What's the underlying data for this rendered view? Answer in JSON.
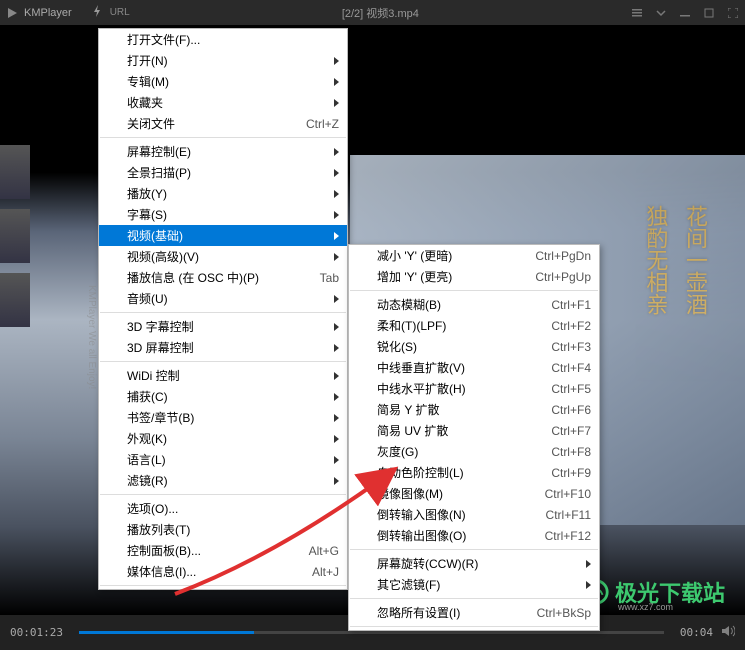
{
  "titlebar": {
    "app_name": "KMPlayer",
    "url_label": "URL",
    "file_info": "[2/2] 视频3.mp4"
  },
  "playbar": {
    "current_time": "00:01:23",
    "total_time": "00:04"
  },
  "sidebar_text": "KMPlayer We all Enjoy!",
  "watermark": {
    "site": "极光下载站",
    "domain": "www.xz7.com"
  },
  "menu1": {
    "open_file": "打开文件(F)...",
    "open": "打开(N)",
    "album": "专辑(M)",
    "favorites": "收藏夹",
    "close_file": "关闭文件",
    "close_file_shortcut": "Ctrl+Z",
    "screen_control": "屏幕控制(E)",
    "panorama": "全景扫描(P)",
    "play": "播放(Y)",
    "subtitles": "字幕(S)",
    "video_basic": "视频(基础)",
    "video_advanced": "视频(高级)(V)",
    "play_info": "播放信息 (在 OSC 中)(P)",
    "play_info_shortcut": "Tab",
    "audio": "音频(U)",
    "subtitle_3d": "3D 字幕控制",
    "screen_3d": "3D 屏幕控制",
    "widi": "WiDi 控制",
    "capture": "捕获(C)",
    "bookmark": "书签/章节(B)",
    "appearance": "外观(K)",
    "language": "语言(L)",
    "filter": "滤镜(R)",
    "options": "选项(O)...",
    "playlist": "播放列表(T)",
    "control_panel": "控制面板(B)...",
    "control_panel_shortcut": "Alt+G",
    "media_info": "媒体信息(I)...",
    "media_info_shortcut": "Alt+J"
  },
  "menu2": {
    "dec_y": "减小 'Y' (更暗)",
    "dec_y_shortcut": "Ctrl+PgDn",
    "inc_y": "增加 'Y' (更亮)",
    "inc_y_shortcut": "Ctrl+PgUp",
    "motion_blur": "动态模糊(B)",
    "motion_blur_shortcut": "Ctrl+F1",
    "soft_lpf": "柔和(T)(LPF)",
    "soft_lpf_shortcut": "Ctrl+F2",
    "sharpen": "锐化(S)",
    "sharpen_shortcut": "Ctrl+F3",
    "center_v": "中线垂直扩散(V)",
    "center_v_shortcut": "Ctrl+F4",
    "center_h": "中线水平扩散(H)",
    "center_h_shortcut": "Ctrl+F5",
    "simple_y": "简易 Y 扩散",
    "simple_y_shortcut": "Ctrl+F6",
    "simple_uv": "简易 UV 扩散",
    "simple_uv_shortcut": "Ctrl+F7",
    "gray": "灰度(G)",
    "gray_shortcut": "Ctrl+F8",
    "auto_level": "自动色阶控制(L)",
    "auto_level_shortcut": "Ctrl+F9",
    "mirror": "镜像图像(M)",
    "mirror_shortcut": "Ctrl+F10",
    "flip_in": "倒转输入图像(N)",
    "flip_in_shortcut": "Ctrl+F11",
    "flip_out": "倒转输出图像(O)",
    "flip_out_shortcut": "Ctrl+F12",
    "screen_rotate": "屏幕旋转(CCW)(R)",
    "other_filter": "其它滤镜(F)",
    "ignore_all": "忽略所有设置(I)",
    "ignore_all_shortcut": "Ctrl+BkSp"
  }
}
